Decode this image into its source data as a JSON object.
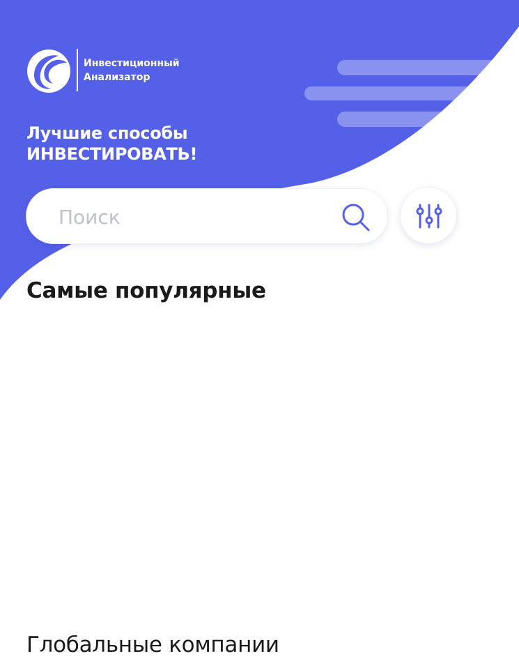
{
  "colors": {
    "brand": "#5560E8",
    "accent_light": "#8A92EF",
    "text_dark": "#1A1A1A",
    "placeholder": "#BFC1CC",
    "icon": "#5560E8"
  },
  "logo": {
    "line1": "Инвестиционный",
    "line2": "Анализатор",
    "icon": "orbit-logo-icon"
  },
  "hero": {
    "line1": "Лучшие способы",
    "line2": "ИНВЕСТИРОВАТЬ!"
  },
  "search": {
    "placeholder": "Поиск",
    "value": "",
    "icon": "search-icon"
  },
  "filter": {
    "icon": "sliders-icon"
  },
  "sections": {
    "popular": "Самые популярные",
    "global": "Глобальные компании"
  }
}
